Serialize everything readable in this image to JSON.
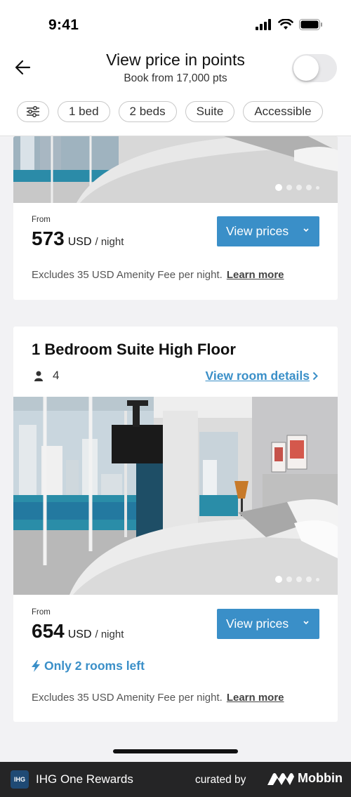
{
  "status_bar": {
    "time": "9:41"
  },
  "header": {
    "title": "View price in points",
    "subtitle": "Book from 17,000 pts",
    "toggle_on": false
  },
  "filters": [
    "1 bed",
    "2 beds",
    "Suite",
    "Accessible"
  ],
  "card1": {
    "from_label": "From",
    "price": "573",
    "currency": "USD",
    "per_night": "/ night",
    "button": "View prices",
    "fee_text": "Excludes 35 USD Amenity Fee per night.",
    "learn_more": "Learn more"
  },
  "card2": {
    "room_name": "1 Bedroom Suite High Floor",
    "guests": "4",
    "details_link": "View room details",
    "from_label": "From",
    "price": "654",
    "currency": "USD",
    "per_night": "/ night",
    "button": "View prices",
    "availability": "Only 2 rooms left",
    "fee_text": "Excludes 35 USD Amenity Fee per night.",
    "learn_more": "Learn more"
  },
  "footer": {
    "logo_text": "IHG",
    "brand": "IHG One Rewards",
    "curated_by": "curated by",
    "mobbin": "Mobbin"
  },
  "colors": {
    "accent": "#3a8fc8",
    "footer_bg": "#252526",
    "page_bg": "#f2f2f4"
  },
  "icons": {
    "back": "arrow-left-icon",
    "filter": "sliders-icon",
    "guests": "person-icon",
    "availability": "lightning-icon",
    "chevron": "chevron-down-icon"
  }
}
